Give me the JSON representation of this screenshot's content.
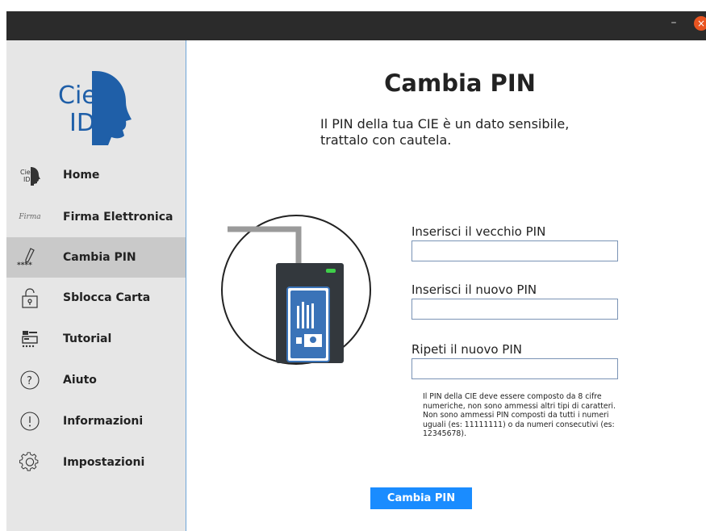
{
  "window": {
    "minimize_label": "–",
    "close_label": "×"
  },
  "logo": {
    "line1": "Cie",
    "line2": "ID",
    "colors": {
      "text": "#1f5fa8",
      "face": "#1f5fa8"
    }
  },
  "sidebar": {
    "items": [
      {
        "label": "Home",
        "icon": "cie-id-icon"
      },
      {
        "label": "Firma Elettronica",
        "icon": "signature-icon"
      },
      {
        "label": "Cambia PIN",
        "icon": "pencil-pin-icon",
        "active": true
      },
      {
        "label": "Sblocca Carta",
        "icon": "padlock-icon"
      },
      {
        "label": "Tutorial",
        "icon": "tutorial-icon"
      },
      {
        "label": "Aiuto",
        "icon": "question-icon"
      },
      {
        "label": "Informazioni",
        "icon": "info-icon"
      },
      {
        "label": "Impostazioni",
        "icon": "gear-icon"
      }
    ],
    "home_icon_text": "Cie ID",
    "signature_icon_text": "Firma",
    "pin_icon_text": "****"
  },
  "main": {
    "title": "Cambia PIN",
    "subtitle_line1": "Il PIN della tua CIE è un dato sensibile,",
    "subtitle_line2": "trattalo con cautela."
  },
  "form": {
    "old_pin_label": "Inserisci il vecchio PIN",
    "old_pin_value": "",
    "new_pin_label": "Inserisci il nuovo PIN",
    "new_pin_value": "",
    "repeat_pin_label": "Ripeti il nuovo PIN",
    "repeat_pin_value": "",
    "help_text": "Il PIN della CIE deve essere composto da 8 cifre numeriche, non sono ammessi altri tipi di caratteri. Non sono ammessi PIN composti da tutti i numeri uguali (es: 11111111) o da numeri consecutivi (es: 12345678).",
    "submit_label": "Cambia PIN"
  },
  "colors": {
    "accent": "#1a8cff",
    "sidebar_bg": "#e6e6e6",
    "sidebar_active": "#c9c9c9",
    "titlebar": "#2b2b2b",
    "close": "#e95420"
  }
}
